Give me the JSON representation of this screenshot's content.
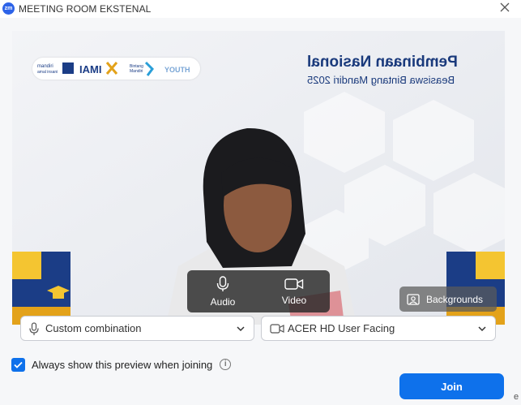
{
  "window": {
    "app_icon_text": "zm",
    "title": "MEETING ROOM EKSTENAL",
    "close_icon": "close-icon"
  },
  "preview": {
    "banner_title": "Pembinaan Nasional",
    "banner_subtitle": "Beasiswa Bintang Mandiri 2025",
    "sponsor_logos": [
      "mandiri amal insani",
      "IAMI",
      "Bintang Mandiri",
      "YOUTH"
    ],
    "controls": {
      "audio_label": "Audio",
      "video_label": "Video",
      "backgrounds_label": "Backgrounds"
    }
  },
  "devices": {
    "audio_selected": "Custom combination",
    "video_selected": "ACER HD User Facing"
  },
  "footer": {
    "always_show_label": "Always show this preview when joining",
    "always_show_checked": true,
    "join_label": "Join",
    "edge_text": "e"
  },
  "colors": {
    "accent": "#0e71eb",
    "banner_text": "#1a3a7c",
    "app_logo": "#2d63e8"
  }
}
